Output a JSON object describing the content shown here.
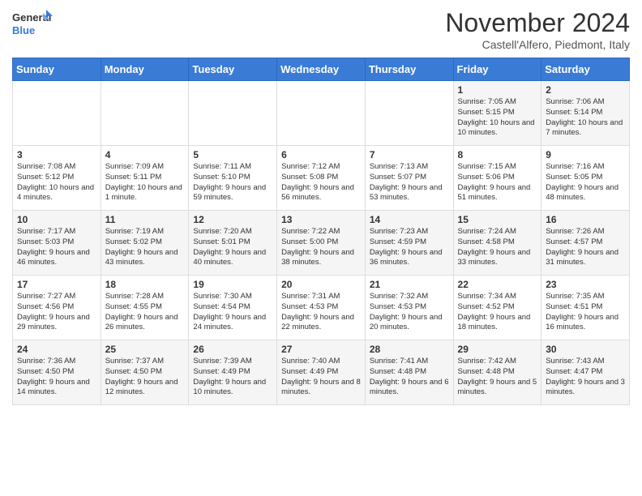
{
  "logo": {
    "line1": "General",
    "line2": "Blue"
  },
  "title": "November 2024",
  "subtitle": "Castell'Alfero, Piedmont, Italy",
  "weekdays": [
    "Sunday",
    "Monday",
    "Tuesday",
    "Wednesday",
    "Thursday",
    "Friday",
    "Saturday"
  ],
  "weeks": [
    [
      {
        "day": "",
        "info": ""
      },
      {
        "day": "",
        "info": ""
      },
      {
        "day": "",
        "info": ""
      },
      {
        "day": "",
        "info": ""
      },
      {
        "day": "",
        "info": ""
      },
      {
        "day": "1",
        "info": "Sunrise: 7:05 AM\nSunset: 5:15 PM\nDaylight: 10 hours and 10 minutes."
      },
      {
        "day": "2",
        "info": "Sunrise: 7:06 AM\nSunset: 5:14 PM\nDaylight: 10 hours and 7 minutes."
      }
    ],
    [
      {
        "day": "3",
        "info": "Sunrise: 7:08 AM\nSunset: 5:12 PM\nDaylight: 10 hours and 4 minutes."
      },
      {
        "day": "4",
        "info": "Sunrise: 7:09 AM\nSunset: 5:11 PM\nDaylight: 10 hours and 1 minute."
      },
      {
        "day": "5",
        "info": "Sunrise: 7:11 AM\nSunset: 5:10 PM\nDaylight: 9 hours and 59 minutes."
      },
      {
        "day": "6",
        "info": "Sunrise: 7:12 AM\nSunset: 5:08 PM\nDaylight: 9 hours and 56 minutes."
      },
      {
        "day": "7",
        "info": "Sunrise: 7:13 AM\nSunset: 5:07 PM\nDaylight: 9 hours and 53 minutes."
      },
      {
        "day": "8",
        "info": "Sunrise: 7:15 AM\nSunset: 5:06 PM\nDaylight: 9 hours and 51 minutes."
      },
      {
        "day": "9",
        "info": "Sunrise: 7:16 AM\nSunset: 5:05 PM\nDaylight: 9 hours and 48 minutes."
      }
    ],
    [
      {
        "day": "10",
        "info": "Sunrise: 7:17 AM\nSunset: 5:03 PM\nDaylight: 9 hours and 46 minutes."
      },
      {
        "day": "11",
        "info": "Sunrise: 7:19 AM\nSunset: 5:02 PM\nDaylight: 9 hours and 43 minutes."
      },
      {
        "day": "12",
        "info": "Sunrise: 7:20 AM\nSunset: 5:01 PM\nDaylight: 9 hours and 40 minutes."
      },
      {
        "day": "13",
        "info": "Sunrise: 7:22 AM\nSunset: 5:00 PM\nDaylight: 9 hours and 38 minutes."
      },
      {
        "day": "14",
        "info": "Sunrise: 7:23 AM\nSunset: 4:59 PM\nDaylight: 9 hours and 36 minutes."
      },
      {
        "day": "15",
        "info": "Sunrise: 7:24 AM\nSunset: 4:58 PM\nDaylight: 9 hours and 33 minutes."
      },
      {
        "day": "16",
        "info": "Sunrise: 7:26 AM\nSunset: 4:57 PM\nDaylight: 9 hours and 31 minutes."
      }
    ],
    [
      {
        "day": "17",
        "info": "Sunrise: 7:27 AM\nSunset: 4:56 PM\nDaylight: 9 hours and 29 minutes."
      },
      {
        "day": "18",
        "info": "Sunrise: 7:28 AM\nSunset: 4:55 PM\nDaylight: 9 hours and 26 minutes."
      },
      {
        "day": "19",
        "info": "Sunrise: 7:30 AM\nSunset: 4:54 PM\nDaylight: 9 hours and 24 minutes."
      },
      {
        "day": "20",
        "info": "Sunrise: 7:31 AM\nSunset: 4:53 PM\nDaylight: 9 hours and 22 minutes."
      },
      {
        "day": "21",
        "info": "Sunrise: 7:32 AM\nSunset: 4:53 PM\nDaylight: 9 hours and 20 minutes."
      },
      {
        "day": "22",
        "info": "Sunrise: 7:34 AM\nSunset: 4:52 PM\nDaylight: 9 hours and 18 minutes."
      },
      {
        "day": "23",
        "info": "Sunrise: 7:35 AM\nSunset: 4:51 PM\nDaylight: 9 hours and 16 minutes."
      }
    ],
    [
      {
        "day": "24",
        "info": "Sunrise: 7:36 AM\nSunset: 4:50 PM\nDaylight: 9 hours and 14 minutes."
      },
      {
        "day": "25",
        "info": "Sunrise: 7:37 AM\nSunset: 4:50 PM\nDaylight: 9 hours and 12 minutes."
      },
      {
        "day": "26",
        "info": "Sunrise: 7:39 AM\nSunset: 4:49 PM\nDaylight: 9 hours and 10 minutes."
      },
      {
        "day": "27",
        "info": "Sunrise: 7:40 AM\nSunset: 4:49 PM\nDaylight: 9 hours and 8 minutes."
      },
      {
        "day": "28",
        "info": "Sunrise: 7:41 AM\nSunset: 4:48 PM\nDaylight: 9 hours and 6 minutes."
      },
      {
        "day": "29",
        "info": "Sunrise: 7:42 AM\nSunset: 4:48 PM\nDaylight: 9 hours and 5 minutes."
      },
      {
        "day": "30",
        "info": "Sunrise: 7:43 AM\nSunset: 4:47 PM\nDaylight: 9 hours and 3 minutes."
      }
    ]
  ]
}
